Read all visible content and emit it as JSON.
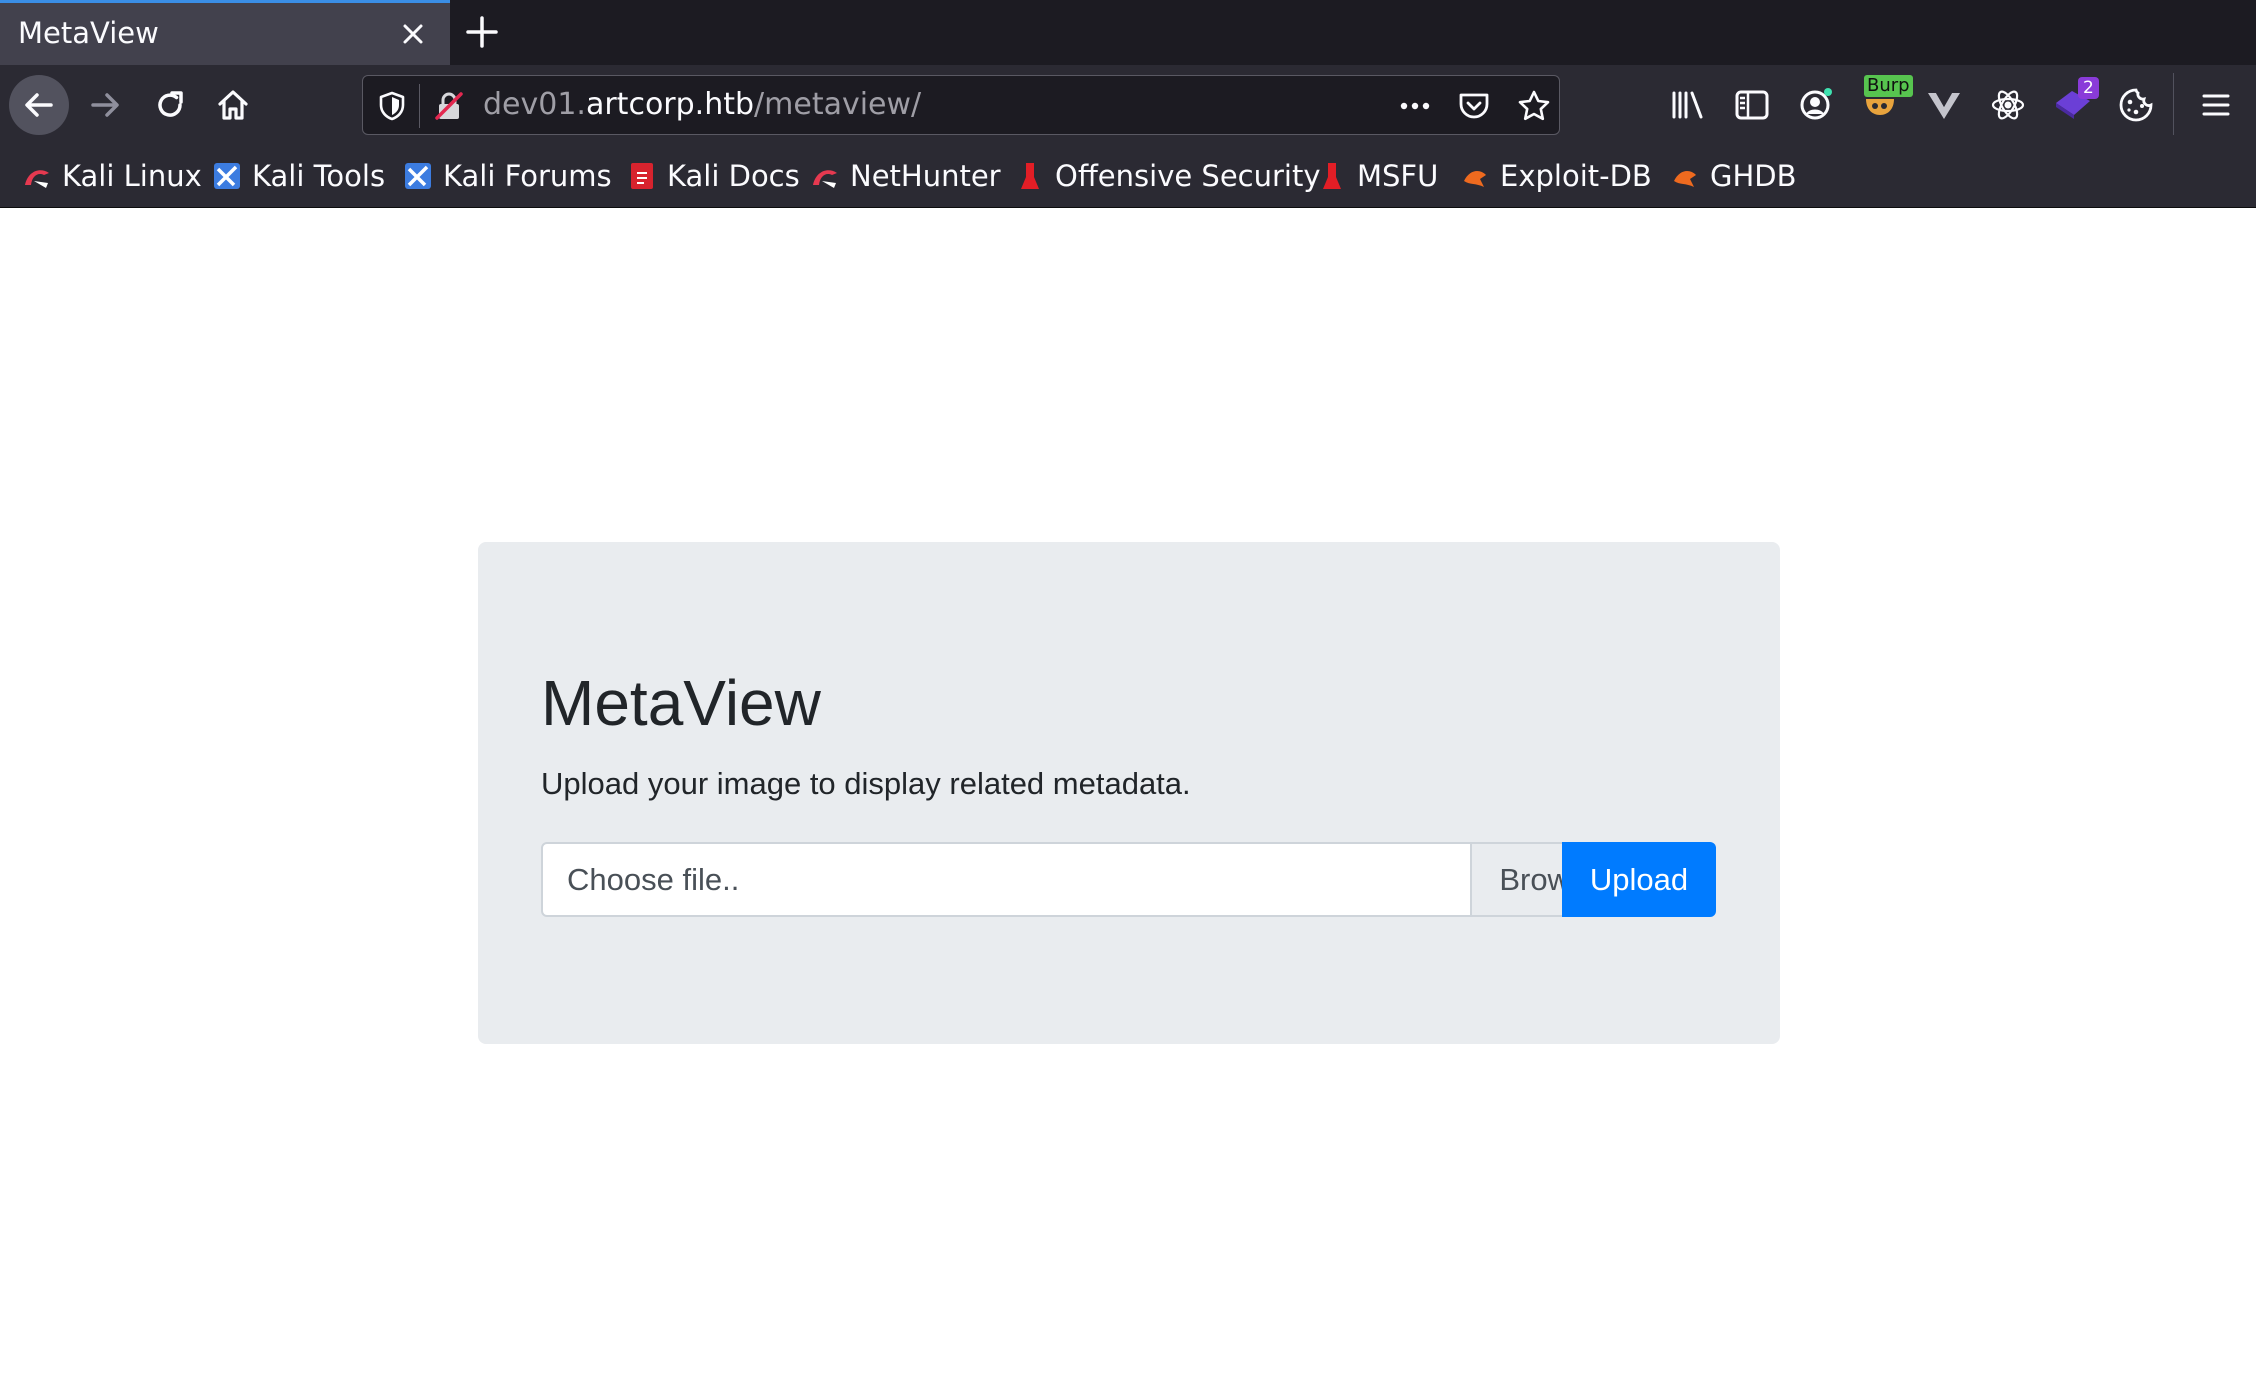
{
  "browser": {
    "tab": {
      "title": "MetaView"
    },
    "url": {
      "host_prefix": "dev01.",
      "host": "artcorp.htb",
      "path": "/metaview/"
    },
    "toolbar_badges": {
      "burp": "Burp",
      "notification_count": "2"
    },
    "bookmarks": [
      {
        "label": "Kali Linux",
        "icon": "kali-dragon-icon"
      },
      {
        "label": "Kali Tools",
        "icon": "kali-tools-icon"
      },
      {
        "label": "Kali Forums",
        "icon": "kali-forums-icon"
      },
      {
        "label": "Kali Docs",
        "icon": "kali-docs-icon"
      },
      {
        "label": "NetHunter",
        "icon": "nethunter-icon"
      },
      {
        "label": "Offensive Security",
        "icon": "offsec-icon"
      },
      {
        "label": "MSFU",
        "icon": "msfu-icon"
      },
      {
        "label": "Exploit-DB",
        "icon": "exploitdb-icon"
      },
      {
        "label": "GHDB",
        "icon": "ghdb-icon"
      }
    ]
  },
  "page": {
    "title": "MetaView",
    "lead": "Upload your image to display related metadata.",
    "file_input": {
      "placeholder": "Choose file..",
      "browse_label": "Browse"
    },
    "upload_label": "Upload"
  },
  "colors": {
    "primary": "#007bff",
    "jumbotron_bg": "#e9ecef",
    "browser_chrome": "#2b2a33",
    "tab_active": "#42414d"
  }
}
